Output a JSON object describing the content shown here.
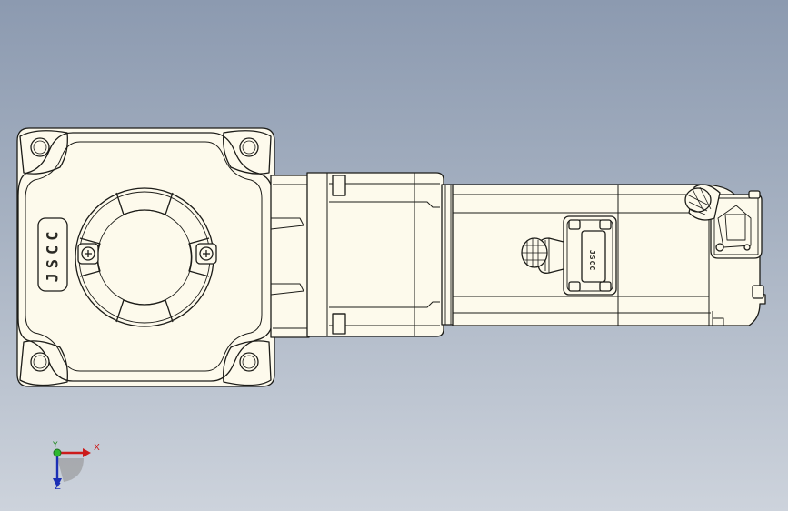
{
  "model": {
    "brand_text": "JSCC",
    "connector_text": "JSCC",
    "body_color": "#fdfaec",
    "outline_color": "#1c1c18",
    "background_top": "#8c9ab0",
    "background_bottom": "#cdd3dc"
  },
  "triad": {
    "x_label": "X",
    "y_label": "Y",
    "z_label": "Z",
    "x_color": "#cc1b1b",
    "y_color": "#1f8a1f",
    "z_color": "#1b2fb5"
  }
}
